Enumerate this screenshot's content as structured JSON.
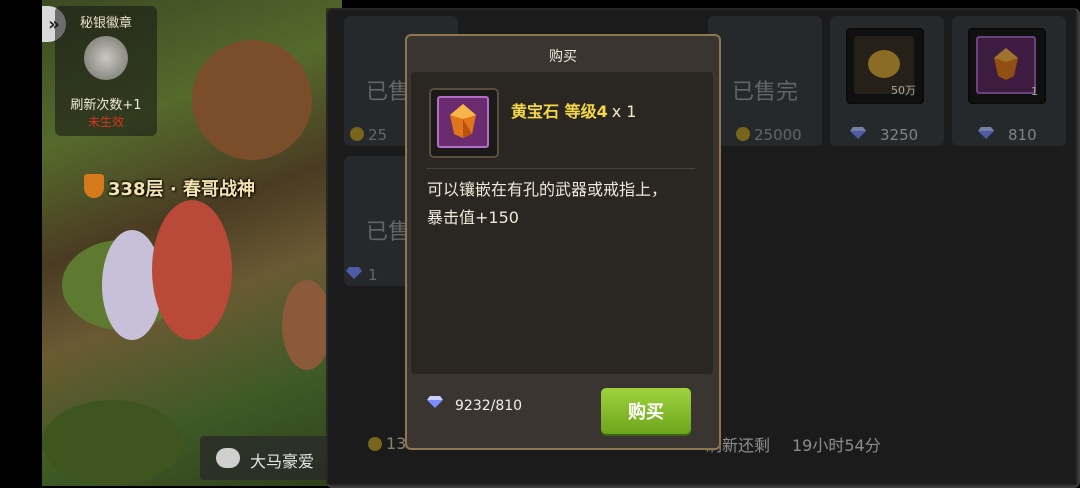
{
  "left_panel": {
    "badge_title": "秘银徽章",
    "refresh_count": "刷新次数+1",
    "status": "未生效",
    "floor_label": "338层 · 春哥战神",
    "arrow": "»"
  },
  "chat": {
    "text": "大马豪爱"
  },
  "shop": {
    "slots": [
      {
        "sold_label": "已售",
        "price": "25"
      },
      {
        "sold_label": "已售完",
        "price": "25000"
      },
      {
        "quantity": "50万",
        "price": "3250"
      },
      {
        "quantity": "1",
        "price": "810"
      },
      {
        "sold_label": "已售",
        "price": "1"
      }
    ],
    "bottom": {
      "coins": "13",
      "refresh_label": "刷新还剩",
      "time_left": "19小时54分"
    }
  },
  "dialog": {
    "title": "购买",
    "item_name": "黄宝石 等级4",
    "item_qty": "x 1",
    "description_line1": "可以镶嵌在有孔的武器或戒指上，",
    "description_line2": "暴击值+150",
    "balance": "9232/810",
    "buy_label": "购买"
  },
  "colors": {
    "accent_green": "#8cc234",
    "item_name_gold": "#f5d84a",
    "status_red": "#d7331f"
  }
}
